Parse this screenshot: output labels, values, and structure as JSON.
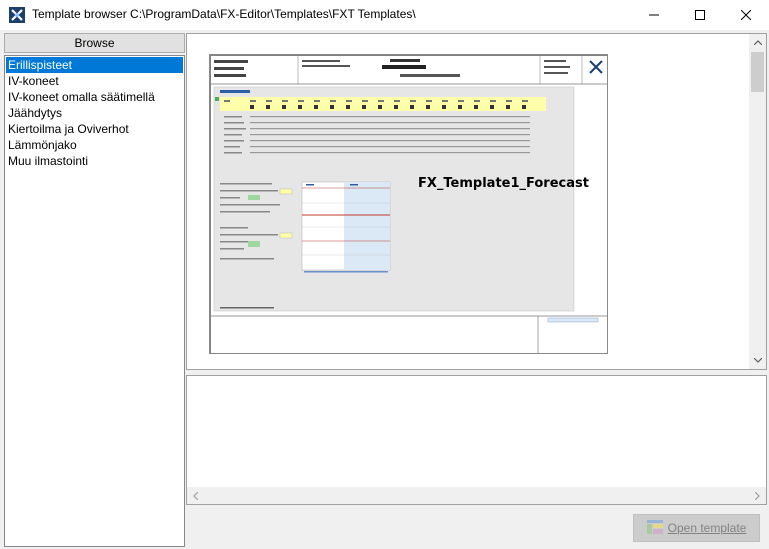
{
  "window": {
    "title": "Template browser C:\\ProgramData\\FX-Editor\\Templates\\FXT Templates\\"
  },
  "sidebar": {
    "header": "Browse",
    "items": [
      {
        "label": "Erillispisteet",
        "selected": true
      },
      {
        "label": "IV-koneet",
        "selected": false
      },
      {
        "label": "IV-koneet omalla säätimellä",
        "selected": false
      },
      {
        "label": "Jäähdytys",
        "selected": false
      },
      {
        "label": "Kiertoilma ja Oviverhot",
        "selected": false
      },
      {
        "label": "Lämmönjako",
        "selected": false
      },
      {
        "label": "Muu ilmastointi",
        "selected": false
      }
    ]
  },
  "preview": {
    "template_name": "FX_Template1_Forecast"
  },
  "actions": {
    "open_label": "Open template"
  },
  "colors": {
    "selection": "#0078d7",
    "thumb_header": "#ffffaa",
    "chart_band": "#dbe8f6",
    "chart_red": "#c0392b"
  }
}
